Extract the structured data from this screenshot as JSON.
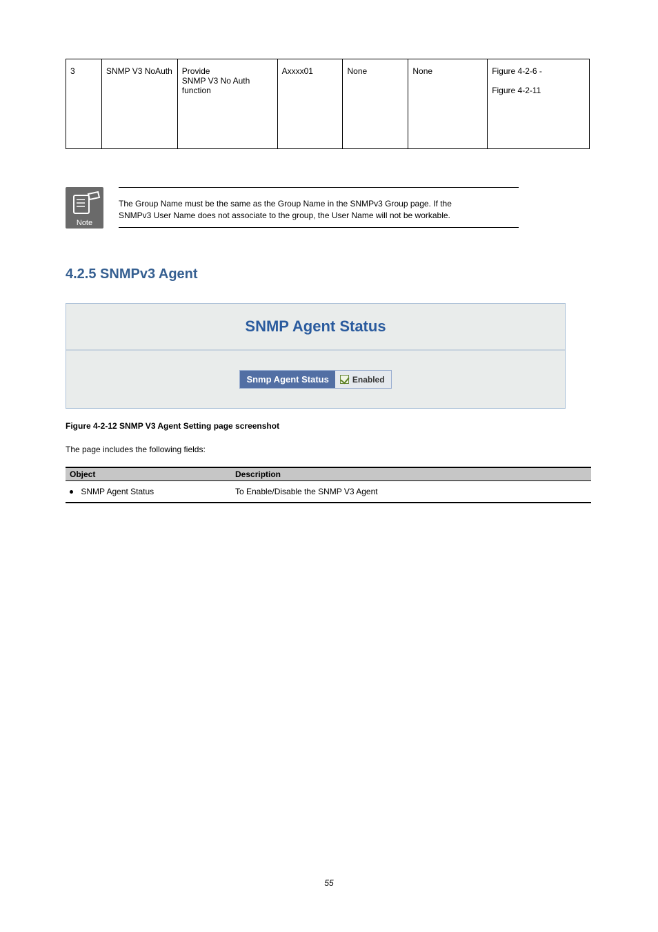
{
  "table1": {
    "r0": {
      "no": "3",
      "a": "SNMP V3 NoAuth",
      "b": "SNMP V3 NoAuth function",
      "c": "Axxxx01",
      "d": "None",
      "e": "None",
      "f": "Figure 4-2-6 -"
    },
    "r1": {
      "a": "",
      "b": "Provide",
      "c": "",
      "d": "",
      "e": "",
      "f": ""
    },
    "r2": {
      "a": "",
      "b": "SNMP V3 No Auth",
      "c": "",
      "d": "",
      "e": "",
      "f": "Figure 4-2-11"
    },
    "r3": {
      "a": "",
      "b": "function",
      "c": "",
      "d": "",
      "e": "",
      "f": ""
    }
  },
  "note": {
    "icon_label": "Note",
    "text": "The Group Name must be the same as the Group Name in the SNMPv3 Group page. If the",
    "text2": "SNMPv3 User Name does not associate to the group, the User Name will not be workable."
  },
  "section_title": "4.2.5 SNMPv3 Agent",
  "figure": {
    "panel_title": "SNMP Agent Status",
    "row_label": "Snmp Agent Status",
    "row_value": "Enabled"
  },
  "fig_caption": "Figure 4-2-12  SNMP V3 Agent Setting page screenshot",
  "intro": "The page includes the following fields:",
  "od": {
    "h1": "Object",
    "h2": "Description",
    "r_obj": "SNMP Agent Status",
    "r_desc": "To Enable/Disable the SNMP V3 Agent"
  },
  "page_no": "55"
}
